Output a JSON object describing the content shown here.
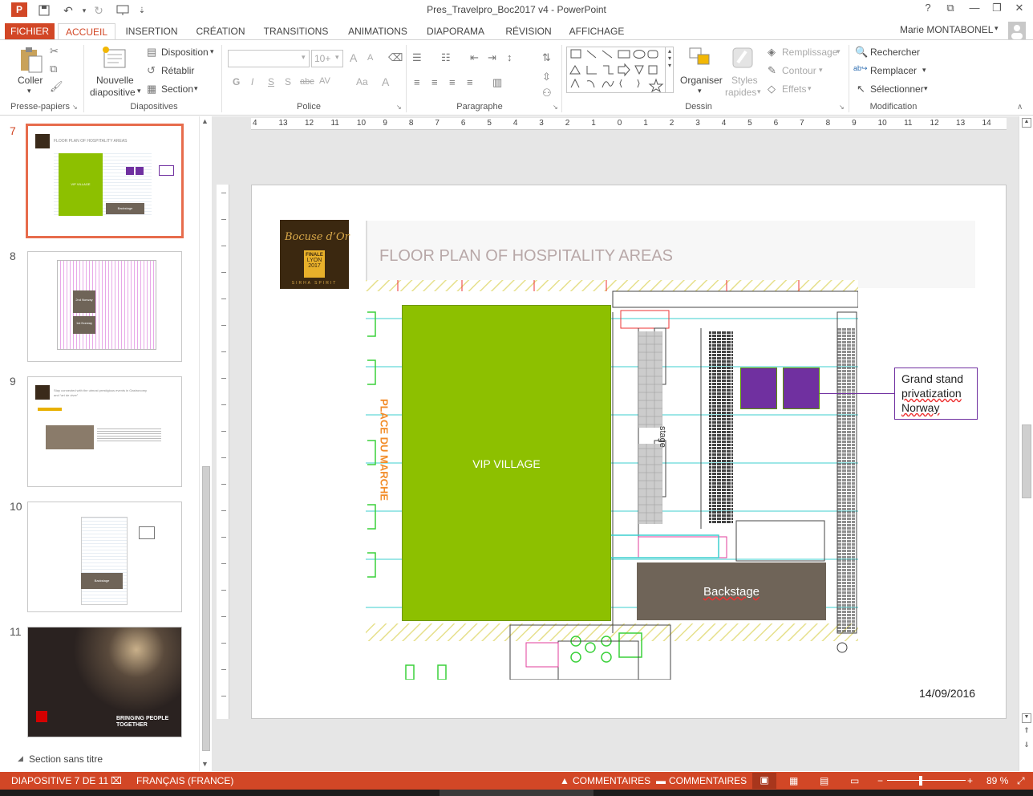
{
  "window": {
    "title": "Pres_Travelpro_Boc2017 v4 - PowerPoint",
    "help": "?",
    "user": "Marie MONTABONEL"
  },
  "tabs": [
    "FICHIER",
    "ACCUEIL",
    "INSERTION",
    "CRÉATION",
    "TRANSITIONS",
    "ANIMATIONS",
    "DIAPORAMA",
    "RÉVISION",
    "AFFICHAGE"
  ],
  "ribbon": {
    "clipboard": {
      "paste": "Coller",
      "label": "Presse-papiers"
    },
    "slides": {
      "new_slide": "Nouvelle diapositive",
      "new_slide_l1": "Nouvelle",
      "new_slide_l2": "diapositive",
      "layout": "Disposition",
      "reset": "Rétablir",
      "section": "Section",
      "label": "Diapositives"
    },
    "font": {
      "size": "10+",
      "label": "Police",
      "bold": "G",
      "italic": "I",
      "underline": "S",
      "shadow": "S",
      "strike": "abc",
      "spacing": "AV",
      "case": "Aa",
      "color": "A",
      "grow": "A",
      "shrink": "A"
    },
    "paragraph": {
      "label": "Paragraphe"
    },
    "drawing": {
      "arrange": "Organiser",
      "styles": "Styles rapides",
      "styles_l1": "Styles",
      "styles_l2": "rapides",
      "fill": "Remplissage",
      "outline": "Contour",
      "effects": "Effets",
      "label": "Dessin"
    },
    "editing": {
      "find": "Rechercher",
      "replace": "Remplacer",
      "select": "Sélectionner",
      "label": "Modification"
    }
  },
  "thumbnails": [
    {
      "num": "7",
      "selected": true,
      "title": "FLOOR PLAN OF HOSPITALITY AREAS",
      "village": "VIP VILLAGE",
      "backstage": "Backstage"
    },
    {
      "num": "8",
      "selected": false,
      "a": "2nd Norway",
      "b": "1st Norway"
    },
    {
      "num": "9",
      "selected": false,
      "text": "Stay connected with the utmost prestigious events in Gastronomy and “art de vivre”"
    },
    {
      "num": "10",
      "selected": false,
      "backstage": "Backstage"
    },
    {
      "num": "11",
      "selected": false,
      "caption": "BRINGING PEOPLE TOGETHER"
    }
  ],
  "section_label": "Section sans titre",
  "ruler_top": [
    "4",
    "13",
    "12",
    "11",
    "10",
    "9",
    "8",
    "7",
    "6",
    "5",
    "4",
    "3",
    "2",
    "1",
    "0",
    "1",
    "2",
    "3",
    "4",
    "5",
    "6",
    "7",
    "8",
    "9",
    "10",
    "11",
    "12",
    "13",
    "14"
  ],
  "slide": {
    "logo": {
      "brand": "Bocuse d’Or",
      "l1": "FINALE",
      "l2": "LYON",
      "l3": "2017",
      "tagline": "SIRHA SPIRIT"
    },
    "title": "FLOOR PLAN OF HOSPITALITY AREAS",
    "place": "PLACE DU MARCHE",
    "vip": "VIP VILLAGE",
    "stage": "stage",
    "backstage": "Backstage",
    "callout": "Grand stand privatization Norway",
    "callout_l1": "Grand stand",
    "callout_l2": "privatization",
    "callout_l3": "Norway",
    "date": "14/09/2016"
  },
  "status": {
    "slide": "DIAPOSITIVE 7 DE 11",
    "language": "FRANÇAIS (FRANCE)",
    "notes": "COMMENTAIRES",
    "comments": "COMMENTAIRES",
    "zoom": "89 %"
  },
  "colors": {
    "accent": "#d24726",
    "vip": "#8dc000",
    "purple": "#7030a0",
    "backstage": "#6f6458"
  }
}
